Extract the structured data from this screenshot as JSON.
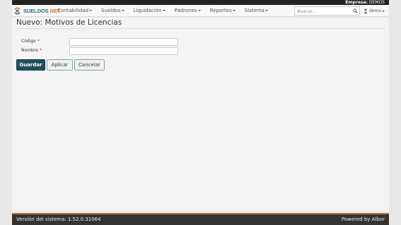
{
  "header": {
    "company_label": "Empresa:",
    "company_name": "DEMOS"
  },
  "navbar": {
    "brand_main": "SUELDOS",
    "brand_accent": "NET",
    "menu": [
      {
        "label": "Contabilidad"
      },
      {
        "label": "Sueldos"
      },
      {
        "label": "Liquidación"
      },
      {
        "label": "Padrones"
      },
      {
        "label": "Reportes"
      },
      {
        "label": "Sistema"
      }
    ],
    "search_placeholder": "Buscar...",
    "user": "demo",
    "icons": {
      "search": "search-icon",
      "user": "user-icon",
      "logo": "brand-logo-icon"
    }
  },
  "form": {
    "title": "Nuevo: Motivos de Licencias",
    "fields": [
      {
        "label": "Código",
        "required_mark": "*",
        "value": ""
      },
      {
        "label": "Nombre",
        "required_mark": "*",
        "value": ""
      }
    ],
    "buttons": {
      "save": "Guardar",
      "apply": "Aplicar",
      "cancel": "Cancelar"
    }
  },
  "footer": {
    "version": "Versión del sistema: 1.52.0.31064",
    "powered": "Powered by Albor"
  },
  "colors": {
    "primary": "#1f4f5f",
    "accent": "#ea6c2b",
    "brand": "#2f6b7c",
    "footer_bg": "#333333"
  }
}
